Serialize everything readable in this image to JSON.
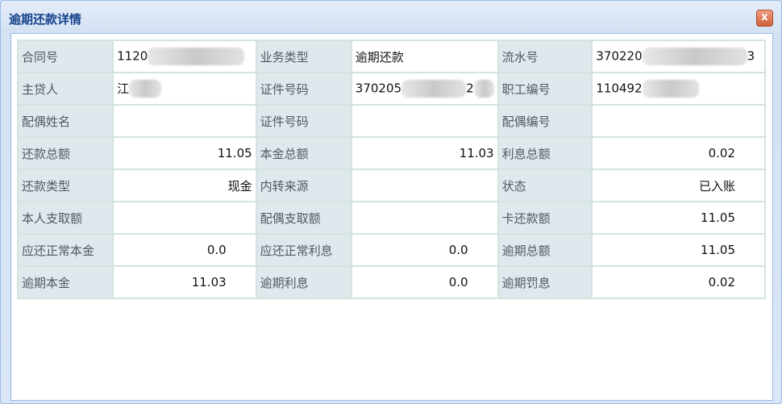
{
  "dialog": {
    "title": "逾期还款详情",
    "close_label": "x"
  },
  "rows": [
    [
      {
        "l": "合同号",
        "v": "1120"
      },
      {
        "l": "业务类型",
        "v": "逾期还款"
      },
      {
        "l": "流水号",
        "v": "370220",
        "v2": "3"
      }
    ],
    [
      {
        "l": "主贷人",
        "v": "江"
      },
      {
        "l": "证件号码",
        "v": "370205",
        "v2": "2"
      },
      {
        "l": "职工编号",
        "v": "110492"
      }
    ],
    [
      {
        "l": "配偶姓名",
        "v": ""
      },
      {
        "l": "证件号码",
        "v": ""
      },
      {
        "l": "配偶编号",
        "v": ""
      }
    ],
    [
      {
        "l": "还款总额",
        "v": "11.05"
      },
      {
        "l": "本金总额",
        "v": "11.03"
      },
      {
        "l": "利息总额",
        "v": "0.02"
      }
    ],
    [
      {
        "l": "还款类型",
        "v": "现金"
      },
      {
        "l": "内转来源",
        "v": ""
      },
      {
        "l": "状态",
        "v": "已入账"
      }
    ],
    [
      {
        "l": "本人支取额",
        "v": ""
      },
      {
        "l": "配偶支取额",
        "v": ""
      },
      {
        "l": "卡还款额",
        "v": "11.05"
      }
    ],
    [
      {
        "l": "应还正常本金",
        "v": "0.0"
      },
      {
        "l": "应还正常利息",
        "v": "0.0"
      },
      {
        "l": "逾期总额",
        "v": "11.05"
      }
    ],
    [
      {
        "l": "逾期本金",
        "v": "11.03"
      },
      {
        "l": "逾期利息",
        "v": "0.0"
      },
      {
        "l": "逾期罚息",
        "v": "0.02"
      }
    ]
  ]
}
